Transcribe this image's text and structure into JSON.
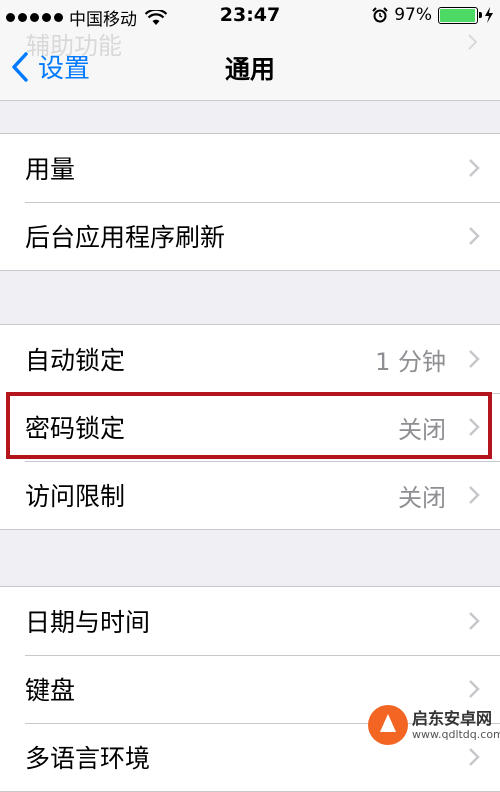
{
  "status_bar": {
    "carrier": "中国移动",
    "time": "23:47",
    "battery_percent": "97%",
    "battery_level": 0.97
  },
  "nav": {
    "back_label": "设置",
    "title": "通用",
    "scrolled_row_label": "辅助功能"
  },
  "groups": [
    {
      "rows": [
        {
          "label": "用量",
          "value": ""
        },
        {
          "label": "后台应用程序刷新",
          "value": ""
        }
      ]
    },
    {
      "rows": [
        {
          "label": "自动锁定",
          "value": "1 分钟"
        },
        {
          "label": "密码锁定",
          "value": "关闭"
        },
        {
          "label": "访问限制",
          "value": "关闭"
        }
      ]
    },
    {
      "rows": [
        {
          "label": "日期与时间",
          "value": ""
        },
        {
          "label": "键盘",
          "value": ""
        },
        {
          "label": "多语言环境",
          "value": ""
        }
      ]
    }
  ],
  "watermark": {
    "name": "启东安卓网",
    "url": "www.qdltdq.com"
  },
  "colors": {
    "accent": "#007aff",
    "highlight_border": "#b4141c",
    "battery": "#4cd964"
  }
}
